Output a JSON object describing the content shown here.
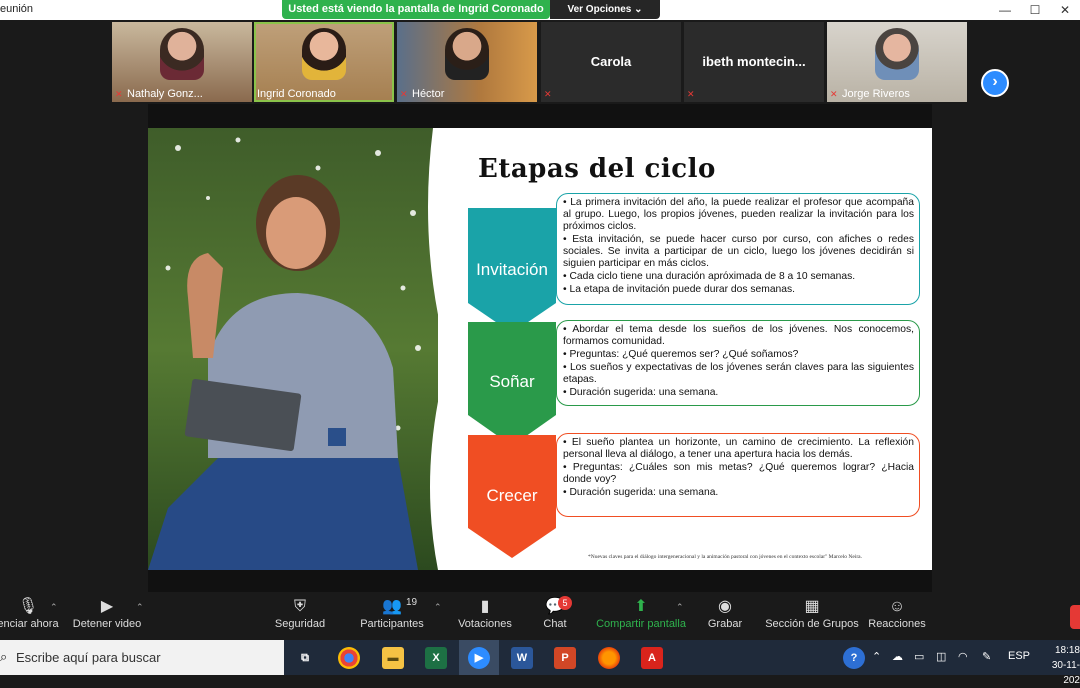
{
  "window": {
    "title": "eunión",
    "minimize": "—",
    "maximize": "☐",
    "close": "✕"
  },
  "share_banner": "Usted está viendo la pantalla de Ingrid Coronado",
  "view_options": "Ver Opciones",
  "participants": [
    {
      "name": "Nathaly Gonz...",
      "muted": true,
      "has_video": true
    },
    {
      "name": "Ingrid Coronado",
      "muted": false,
      "has_video": true,
      "active": true
    },
    {
      "name": "Héctor",
      "muted": true,
      "has_video": true
    },
    {
      "name": "",
      "display_name": "Carola",
      "muted": true,
      "has_video": false
    },
    {
      "name": "",
      "display_name": "ibeth  montecin...",
      "muted": true,
      "has_video": false
    },
    {
      "name": "Jorge Riveros",
      "muted": true,
      "has_video": true
    }
  ],
  "slide": {
    "title": "Etapas del ciclo",
    "stages": [
      {
        "label": "Invitación",
        "color": "#1aa3a8",
        "bullets": [
          "La primera invitación del año, la puede realizar el profesor que acompaña al grupo. Luego, los propios jóvenes, pueden realizar la invitación para los próximos ciclos.",
          "Esta invitación, se puede hacer curso por curso, con afiches o redes sociales. Se invita a participar de un ciclo, luego los jóvenes decidirán si siguien participar en más ciclos.",
          "Cada ciclo tiene una duración aprόximada de 8 a 10 semanas.",
          "La etapa de invitación puede durar dos semanas."
        ]
      },
      {
        "label": "Soñar",
        "color": "#2a9a4a",
        "bullets": [
          "Abordar el tema desde los sueños de los jóvenes. Nos conocemos, formamos comunidad.",
          "Preguntas: ¿Qué queremos ser? ¿Qué soñamos?",
          "Los sueños y expectativas de los jóvenes serán claves para las siguientes etapas.",
          "Duración sugerida: una semana."
        ]
      },
      {
        "label": "Crecer",
        "color": "#f04e23",
        "bullets": [
          "El sueño plantea un horizonte, un camino de crecimiento. La reflexión personal lleva al diálogo, a tener una apertura hacia los demás.",
          "Preguntas: ¿Cuáles son mis metas? ¿Qué queremos lograr? ¿Hacia donde voy?",
          "Duración sugerida: una semana."
        ]
      }
    ],
    "footnote": "*Nuevas claves para el diálogo intergeneracional y la animación pastoral con jóvenes en el contexto escolar\" Marcelo Neira."
  },
  "toolbar": {
    "unmute": "enciar ahora",
    "stop_video": "Detener video",
    "security": "Seguridad",
    "participants": "Participantes",
    "participants_count": "19",
    "polls": "Votaciones",
    "chat": "Chat",
    "chat_badge": "5",
    "share_screen": "Compartir pantalla",
    "record": "Grabar",
    "breakout": "Sección de Grupos",
    "reactions": "Reacciones"
  },
  "taskbar": {
    "search_placeholder": "Escribe aquí para buscar",
    "language": "ESP",
    "time": "18:18",
    "date": "30-11-202"
  },
  "colors": {
    "zoom_green": "#2fb24d",
    "zoom_blue": "#2d8cff",
    "stage_teal": "#1aa3a8",
    "stage_green": "#2a9a4a",
    "stage_orange": "#f04e23"
  }
}
